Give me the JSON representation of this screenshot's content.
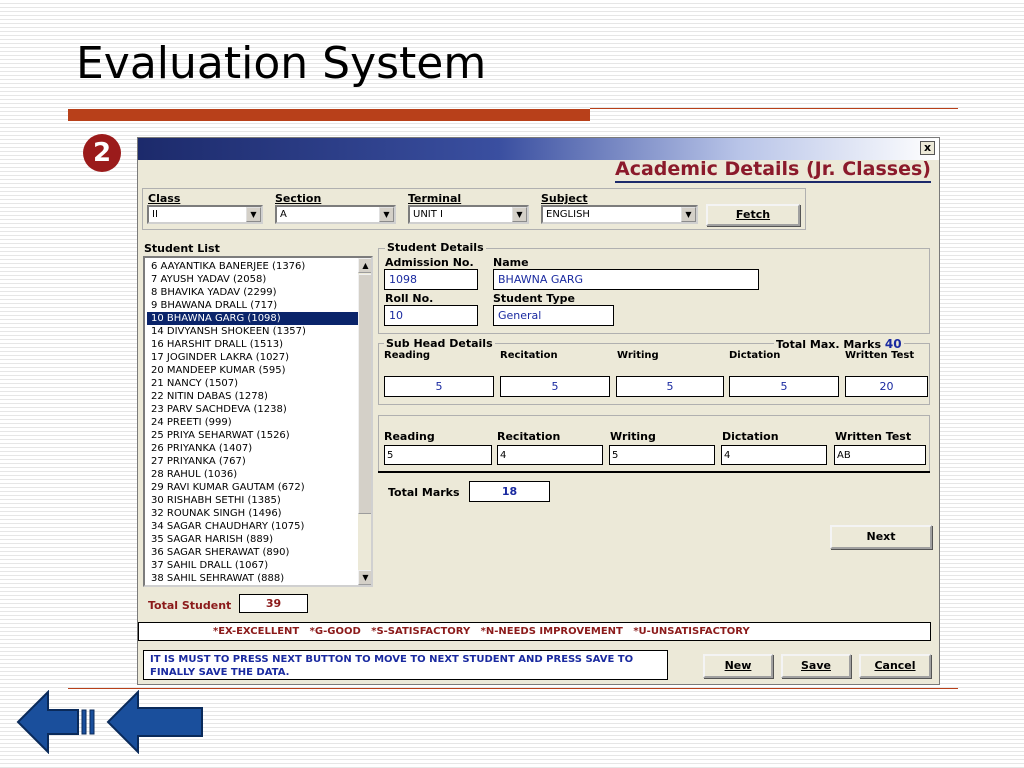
{
  "slide": {
    "title": "Evaluation System",
    "step_number": "2"
  },
  "window": {
    "title": "Academic Details (Jr. Classes)",
    "close_glyph": "x"
  },
  "filters": {
    "class_label": "Class",
    "class_value": "II",
    "section_label": "Section",
    "section_value": "A",
    "terminal_label": "Terminal",
    "terminal_value": "UNIT I",
    "subject_label": "Subject",
    "subject_value": "ENGLISH",
    "fetch_label": "Fetch"
  },
  "student_list": {
    "label": "Student List",
    "items": [
      "6  AAYANTIKA BANERJEE  (1376)",
      "7  AYUSH YADAV  (2058)",
      "8  BHAVIKA YADAV  (2299)",
      "9  BHAWANA  DRALL  (717)",
      "10  BHAWNA GARG  (1098)",
      "14  DIVYANSH SHOKEEN  (1357)",
      "16  HARSHIT DRALL  (1513)",
      "17  JOGINDER LAKRA  (1027)",
      "20  MANDEEP KUMAR  (595)",
      "21  NANCY  (1507)",
      "22  NITIN DABAS  (1278)",
      "23  PARV SACHDEVA  (1238)",
      "24  PREETI  (999)",
      "25  PRIYA SEHARWAT  (1526)",
      "26  PRIYANKA  (1407)",
      "27  PRIYANKA  (767)",
      "28  RAHUL  (1036)",
      "29  RAVI KUMAR GAUTAM  (672)",
      "30  RISHABH SETHI  (1385)",
      "32  ROUNAK SINGH  (1496)",
      "34  SAGAR CHAUDHARY  (1075)",
      "35  SAGAR HARISH  (889)",
      "36  SAGAR  SHERAWAT  (890)",
      "37  SAHIL DRALL  (1067)",
      "38  SAHIL SEHRAWAT  (888)"
    ],
    "selected_index": 4,
    "total_label": "Total Student",
    "total_value": "39"
  },
  "student_details": {
    "group_label": "Student Details",
    "admission_label": "Admission No.",
    "admission_value": "1098",
    "name_label": "Name",
    "name_value": "BHAWNA GARG",
    "roll_label": "Roll No.",
    "roll_value": "10",
    "type_label": "Student Type",
    "type_value": "General"
  },
  "sub_head": {
    "group_label": "Sub Head Details",
    "total_max_label": "Total Max. Marks",
    "total_max_value": "40",
    "columns": [
      "Reading",
      "Recitation",
      "Writing",
      "Dictation",
      "Written Test"
    ],
    "max_values": [
      "5",
      "5",
      "5",
      "5",
      "20"
    ]
  },
  "marks": {
    "columns": [
      "Reading",
      "Recitation",
      "Writing",
      "Dictation",
      "Written Test"
    ],
    "values": [
      "5",
      "4",
      "5",
      "4",
      "AB"
    ],
    "total_label": "Total Marks",
    "total_value": "18"
  },
  "buttons": {
    "next": "Next",
    "new": "New",
    "save": "Save",
    "cancel": "Cancel"
  },
  "legend": "*EX-EXCELLENT   *G-GOOD   *S-SATISFACTORY   *N-NEEDS IMPROVEMENT   *U-UNSATISFACTORY",
  "note": "IT IS MUST TO PRESS NEXT BUTTON TO MOVE TO NEXT STUDENT AND PRESS SAVE TO FINALLY SAVE THE DATA.",
  "colors": {
    "title_red": "#8b1a2b",
    "selection_blue": "#0a246a",
    "value_blue": "#1a2aa0",
    "accent_bar": "#b8401a"
  }
}
